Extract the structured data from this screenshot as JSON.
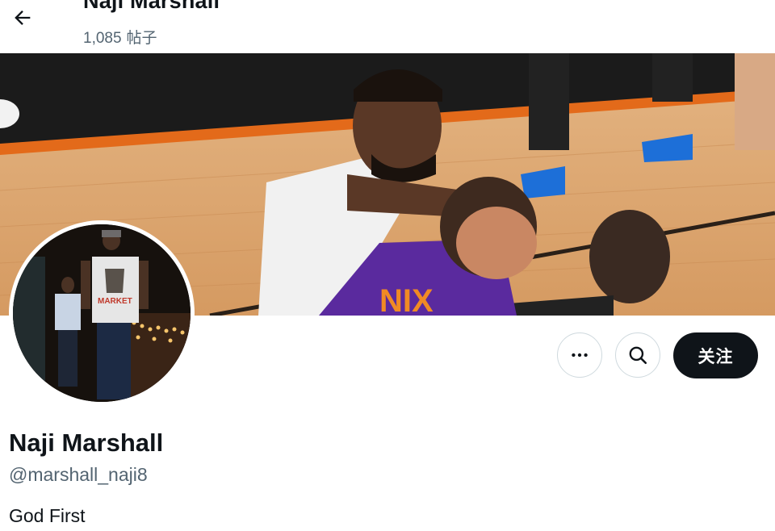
{
  "header": {
    "back_icon": "arrow-left-icon",
    "name": "Naji Marshall",
    "post_count": "1,085",
    "post_count_label": "帖子"
  },
  "profile": {
    "display_name": "Naji Marshall",
    "handle": "@marshall_naji8",
    "bio": "God First"
  },
  "actions": {
    "more_icon": "more-horizontal-icon",
    "search_icon": "search-icon",
    "follow_label": "关注"
  },
  "colors": {
    "text_primary": "#0f1419",
    "text_secondary": "#536471",
    "button_border": "#cfd9de",
    "follow_bg": "#0f1419"
  }
}
